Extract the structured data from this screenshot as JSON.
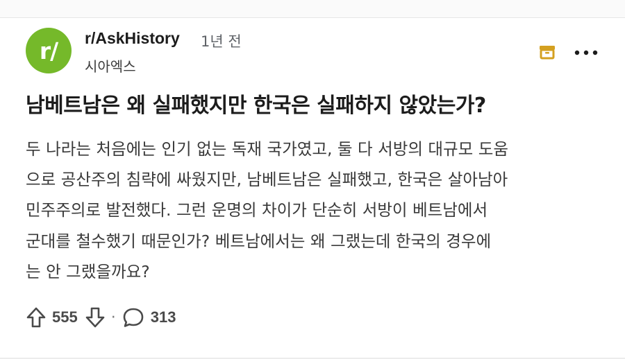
{
  "post": {
    "subreddit": "r/AskHistory",
    "avatar_text": "r/",
    "age": "1년 전",
    "author": "시아엑스",
    "title": "남베트남은 왜 실패했지만 한국은 실패하지 않았는가?",
    "body_lines": [
      "두 나라는 처음에는 인기 없는 독재 국가였고, 둘 다 서방의 대규모 도움",
      "으로 공산주의 침략에 싸웠지만, 남베트남은 실패했고, 한국은 살아남아",
      "민주주의로 발전했다. 그런 운명의 차이가 단순히 서방이 베트남에서",
      "군대를 철수했기 때문인가? 베트남에서는 왜 그랬는데 한국의 경우에",
      "는 안 그랬을까요?"
    ],
    "upvotes": "555",
    "separator": "·",
    "comments": "313"
  },
  "colors": {
    "avatar_bg": "#75b92a",
    "save_icon": "#d4a020",
    "text_primary": "#1c1c1c",
    "text_secondary": "#5f6368"
  },
  "icons": {
    "save": "archive-box-icon",
    "more": "more-horizontal-icon",
    "upvote": "arrow-up-icon",
    "downvote": "arrow-down-icon",
    "comments": "speech-bubble-icon"
  }
}
